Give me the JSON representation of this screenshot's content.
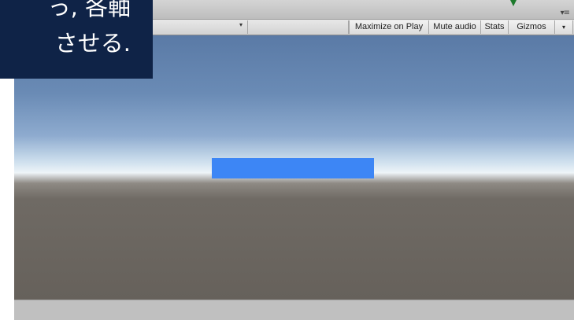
{
  "caption": {
    "line1": "っ, 各軸",
    "line2": "させる."
  },
  "toolbar": {
    "maximize_on_play": "Maximize on Play",
    "mute_audio": "Mute audio",
    "stats": "Stats",
    "gizmos": "Gizmos",
    "dropdown_arrow": "▾",
    "tab_menu": "▾≡"
  },
  "scene": {
    "object_color": "#3d86f5",
    "sky_color": "#6a8bb5",
    "ground_color": "#66615b"
  }
}
